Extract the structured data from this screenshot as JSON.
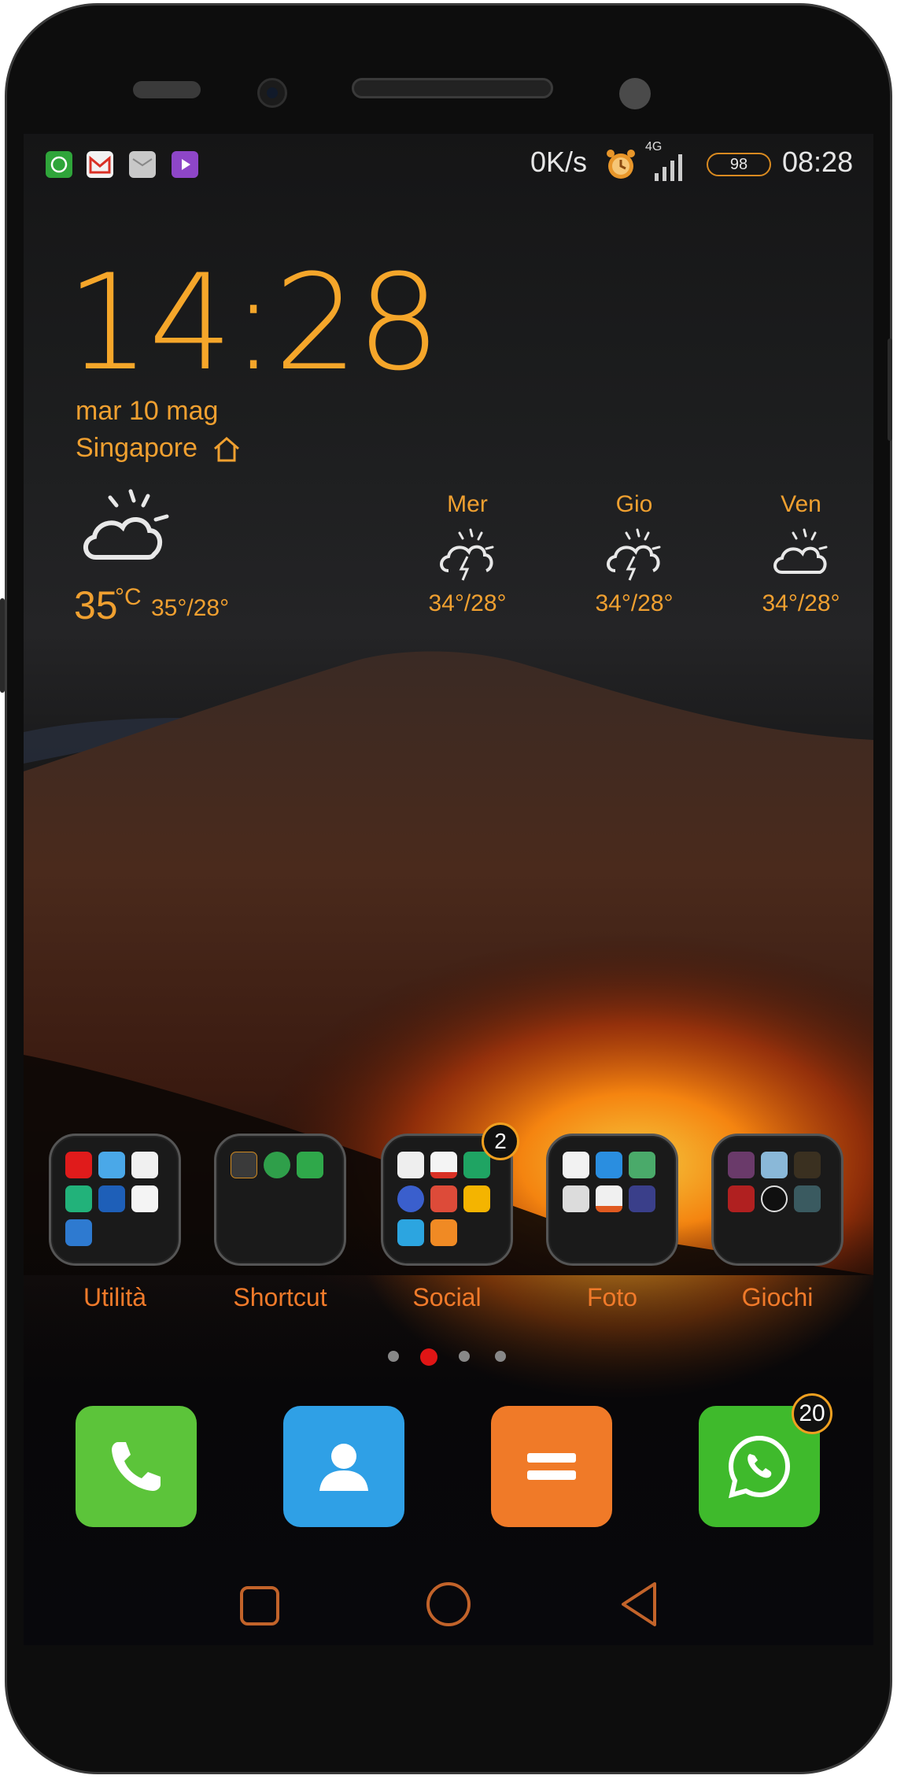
{
  "status_bar": {
    "notification_icons": [
      "whatsapp-icon",
      "gmail-icon",
      "email-icon",
      "play-store-icon"
    ],
    "net_speed": "0K/s",
    "alarm_icon": "alarm-clock-icon",
    "network_type": "4G",
    "battery_level": "98",
    "time": "08:28"
  },
  "clock_widget": {
    "time": "14:28",
    "date": "mar 10 mag",
    "city": "Singapore",
    "city_icon": "home-icon"
  },
  "weather": {
    "current": {
      "temp": "35",
      "unit": "°C",
      "range": "35°/28°",
      "icon": "partly-cloudy-icon"
    },
    "forecast": [
      {
        "day": "Mer",
        "range": "34°/28°",
        "icon": "thunderstorm-icon"
      },
      {
        "day": "Gio",
        "range": "34°/28°",
        "icon": "thunderstorm-icon"
      },
      {
        "day": "Ven",
        "range": "34°/28°",
        "icon": "partly-cloudy-icon"
      }
    ]
  },
  "folders": [
    {
      "label": "Utilità",
      "badge": "",
      "apps": [
        "vodafone-icon",
        "files-icon",
        "waze-icon",
        "security-icon",
        "tim-icon",
        "sky-icon",
        "bot-icon"
      ]
    },
    {
      "label": "Shortcut",
      "badge": "",
      "apps": [
        "xda-icon",
        "refresh-icon",
        "download-icon"
      ]
    },
    {
      "label": "Social",
      "badge": "2",
      "apps": [
        "email-icon",
        "gmail-icon",
        "hangouts-icon",
        "chrome-icon",
        "google-plus-icon",
        "sketch-icon",
        "telegram-icon",
        "chat-icon"
      ]
    },
    {
      "label": "Foto",
      "badge": "",
      "apps": [
        "photos-icon",
        "gallery-icon",
        "landscape-icon",
        "camera-icon",
        "picsay-pro-icon",
        "grid-icon"
      ]
    },
    {
      "label": "Giochi",
      "badge": "",
      "apps": [
        "game-1-icon",
        "frozen-icon",
        "star-wars-icon",
        "racing-icon",
        "mortal-kombat-icon",
        "ninja-icon"
      ]
    }
  ],
  "page_indicator": {
    "pages": 4,
    "active": 2
  },
  "dock": [
    {
      "name": "phone",
      "icon": "phone-icon",
      "color": "#5cc43a",
      "badge": ""
    },
    {
      "name": "contacts",
      "icon": "contact-icon",
      "color": "#2fa0e6",
      "badge": ""
    },
    {
      "name": "app-drawer",
      "icon": "app-drawer-icon",
      "color": "#f07a28",
      "badge": ""
    },
    {
      "name": "whatsapp",
      "icon": "whatsapp-icon",
      "color": "#3fba2c",
      "badge": "20"
    }
  ],
  "navigation": [
    "recents-icon",
    "home-icon",
    "back-icon"
  ],
  "colors": {
    "accent": "#f0a030",
    "label": "#f07a2a",
    "active_dot": "#e01515"
  }
}
